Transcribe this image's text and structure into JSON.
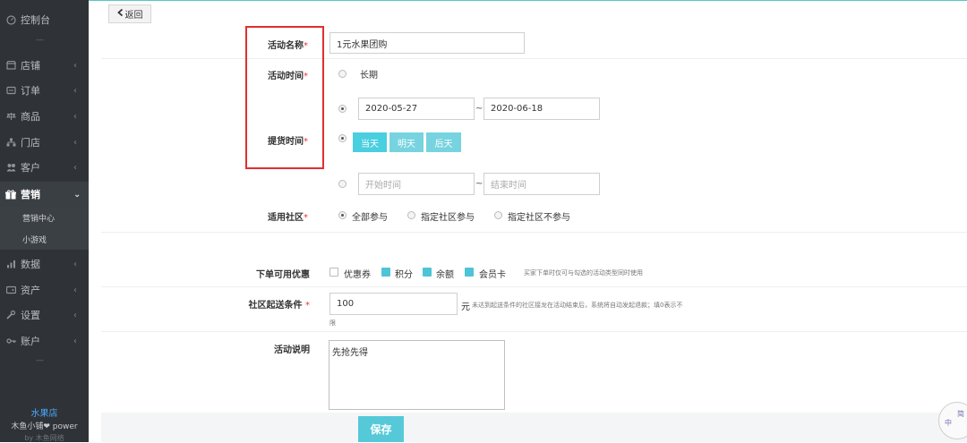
{
  "sidebar": {
    "items": [
      {
        "label": "控制台",
        "icon": "dashboard-icon",
        "chev": ""
      },
      {
        "label": "店铺",
        "icon": "store-icon",
        "chev": "‹"
      },
      {
        "label": "订单",
        "icon": "order-icon",
        "chev": "‹"
      },
      {
        "label": "商品",
        "icon": "scale-icon",
        "chev": "‹"
      },
      {
        "label": "门店",
        "icon": "branch-icon",
        "chev": "‹"
      },
      {
        "label": "客户",
        "icon": "users-icon",
        "chev": "‹"
      },
      {
        "label": "营销",
        "icon": "marketing-icon",
        "chev": "⌄"
      },
      {
        "label": "数据",
        "icon": "chart-icon",
        "chev": "‹"
      },
      {
        "label": "资产",
        "icon": "wallet-icon",
        "chev": "‹"
      },
      {
        "label": "设置",
        "icon": "wrench-icon",
        "chev": "‹"
      },
      {
        "label": "账户",
        "icon": "key-icon",
        "chev": "‹"
      }
    ],
    "sub_items": [
      "营销中心",
      "小游戏"
    ],
    "divider": "—",
    "footer_store": "水果店",
    "footer_power": "木鱼小铺❤ power",
    "footer_by": "by 木鱼网络"
  },
  "header": {
    "back_label": "返回",
    "back_icon": "chevron-left-icon"
  },
  "form": {
    "name": {
      "label": "活动名称",
      "req": "*",
      "value": "1元水果团购"
    },
    "time": {
      "label": "活动时间",
      "req": "*",
      "long_term": "长期",
      "start_date": "2020-05-27",
      "end_date": "2020-06-18",
      "tilde": "~"
    },
    "pickup": {
      "label": "提货时间",
      "req": "*",
      "buttons": [
        "当天",
        "明天",
        "后天"
      ],
      "start_placeholder": "开始时间",
      "end_placeholder": "结束时间",
      "tilde": "~"
    },
    "community": {
      "label": "适用社区",
      "req": "*",
      "options": [
        "全部参与",
        "指定社区参与",
        "指定社区不参与"
      ]
    },
    "discount": {
      "label": "下单可用优惠",
      "options": [
        "优惠券",
        "积分",
        "余额",
        "会员卡"
      ],
      "checked": [
        false,
        true,
        true,
        true
      ],
      "note": "买家下单时仅可与勾选的活动类型同时使用"
    },
    "delivery": {
      "label": "社区起送条件",
      "req": "*",
      "value": "100",
      "unit": "元",
      "note": "未达到起送条件的社区接龙在活动结束后，系统将自动发起退款；填0表示不",
      "note_cont": "限"
    },
    "desc": {
      "label": "活动说明",
      "value": "先抢先得"
    },
    "save_label": "保存"
  },
  "stamp": {
    "char1": "中",
    "char2": "简"
  },
  "colors": {
    "sidebar_bg": "#2f3337",
    "accent": "#49cfe0",
    "required": "#e33333",
    "highlight": "#e03030"
  }
}
